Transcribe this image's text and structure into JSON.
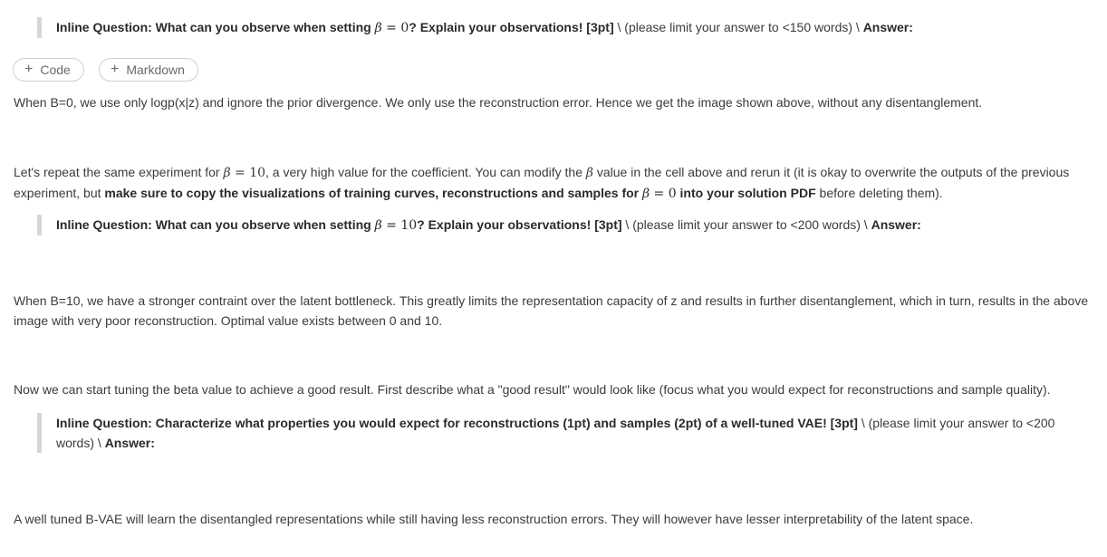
{
  "q1": {
    "prefix": "Inline Question: What can you observe when setting ",
    "beta": "β",
    "eq": " = 0",
    "suffix": "? Explain your observations! [3pt]",
    "limit": " \\ (please limit your answer to <150 words) \\ ",
    "answer": "Answer:"
  },
  "toolbar": {
    "add_code_label": "Code",
    "add_markdown_label": "Markdown"
  },
  "a1": "When B=0, we use only logp(x|z) and ignore the prior divergence. We only use the reconstruction error. Hence we get the image shown above, without any disentanglement.",
  "p2": {
    "t1": "Let's repeat the same experiment for ",
    "beta": "β",
    "eq": " = 10",
    "t2": ", a very high value for the coefficient. You can modify the ",
    "beta2": "β",
    "t3": " value in the cell above and rerun it (it is okay to overwrite the outputs of the previous experiment, but ",
    "bold1": "make sure to copy the visualizations of training curves, reconstructions and samples for ",
    "beta3": "β",
    "eq3": " = 0",
    "bold2": " into your solution PDF",
    "t4": " before deleting them)."
  },
  "q2": {
    "prefix": "Inline Question: What can you observe when setting ",
    "beta": "β",
    "eq": " = 10",
    "suffix": "? Explain your observations! [3pt]",
    "limit": " \\ (please limit your answer to <200 words) \\ ",
    "answer": "Answer:"
  },
  "a2": "When B=10, we have a stronger contraint over the latent bottleneck. This greatly limits the representation capacity of z and results in further disentanglement, which in turn, results in the above image with very poor reconstruction. Optimal value exists between 0 and 10.",
  "p3": "Now we can start tuning the beta value to achieve a good result. First describe what a \"good result\" would look like (focus what you would expect for reconstructions and sample quality).",
  "q3": {
    "text": "Inline Question: Characterize what properties you would expect for reconstructions (1pt) and samples (2pt) of a well-tuned VAE! [3pt]",
    "limit": " \\ (please limit your answer to <200 words) \\ ",
    "answer": "Answer:"
  },
  "a3": "A well tuned B-VAE will learn the disentangled representations while still having less reconstruction errors. They will however have lesser interpretability of the latent space."
}
